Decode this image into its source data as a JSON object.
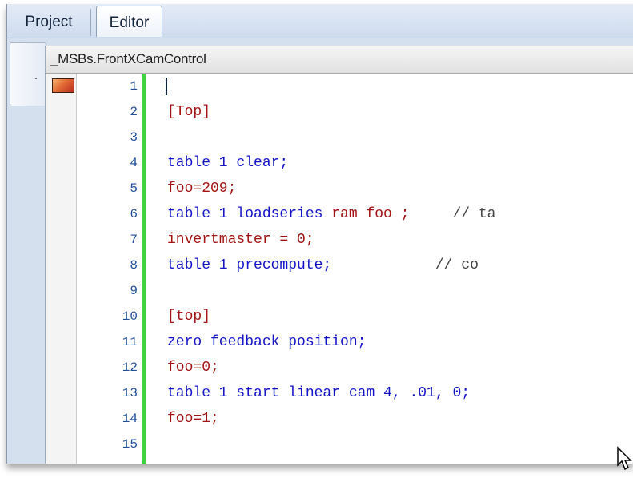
{
  "tabs": {
    "project": "Project",
    "editor": "Editor"
  },
  "side_tab_label": ".",
  "file_tab": "_MSBs.FrontXCamControl",
  "colors": {
    "keyword": "#1414c8",
    "variable": "#a31515",
    "line_number": "#1f4e9b",
    "change_bar": "#3fd43f"
  },
  "lines": [
    {
      "no": "1",
      "parts": [
        {
          "t": "",
          "c": "blue"
        }
      ]
    },
    {
      "no": "2",
      "parts": [
        {
          "t": "[Top]",
          "c": "red"
        }
      ]
    },
    {
      "no": "3",
      "parts": [
        {
          "t": "",
          "c": "blue"
        }
      ]
    },
    {
      "no": "4",
      "parts": [
        {
          "t": "table 1 clear;",
          "c": "blue"
        }
      ]
    },
    {
      "no": "5",
      "parts": [
        {
          "t": "foo=209;",
          "c": "red"
        }
      ]
    },
    {
      "no": "6",
      "parts": [
        {
          "t": "table 1 loadseries ",
          "c": "blue"
        },
        {
          "t": "ram foo ;",
          "c": "red"
        },
        {
          "t": "     // ta",
          "c": "gray"
        }
      ]
    },
    {
      "no": "7",
      "parts": [
        {
          "t": "invertmaster = 0;",
          "c": "red"
        }
      ]
    },
    {
      "no": "8",
      "parts": [
        {
          "t": "table 1 precompute;",
          "c": "blue"
        },
        {
          "t": "            // co",
          "c": "gray"
        }
      ]
    },
    {
      "no": "9",
      "parts": [
        {
          "t": "",
          "c": "blue"
        }
      ]
    },
    {
      "no": "10",
      "parts": [
        {
          "t": "[top]",
          "c": "red"
        }
      ]
    },
    {
      "no": "11",
      "parts": [
        {
          "t": "zero feedback position;",
          "c": "blue"
        }
      ]
    },
    {
      "no": "12",
      "parts": [
        {
          "t": "foo=0;",
          "c": "red"
        }
      ]
    },
    {
      "no": "13",
      "parts": [
        {
          "t": "table 1 start linear cam 4, .01, 0;",
          "c": "blue"
        }
      ]
    },
    {
      "no": "14",
      "parts": [
        {
          "t": "foo=1;",
          "c": "red"
        }
      ]
    },
    {
      "no": "15",
      "parts": [
        {
          "t": "",
          "c": "blue"
        }
      ]
    }
  ]
}
